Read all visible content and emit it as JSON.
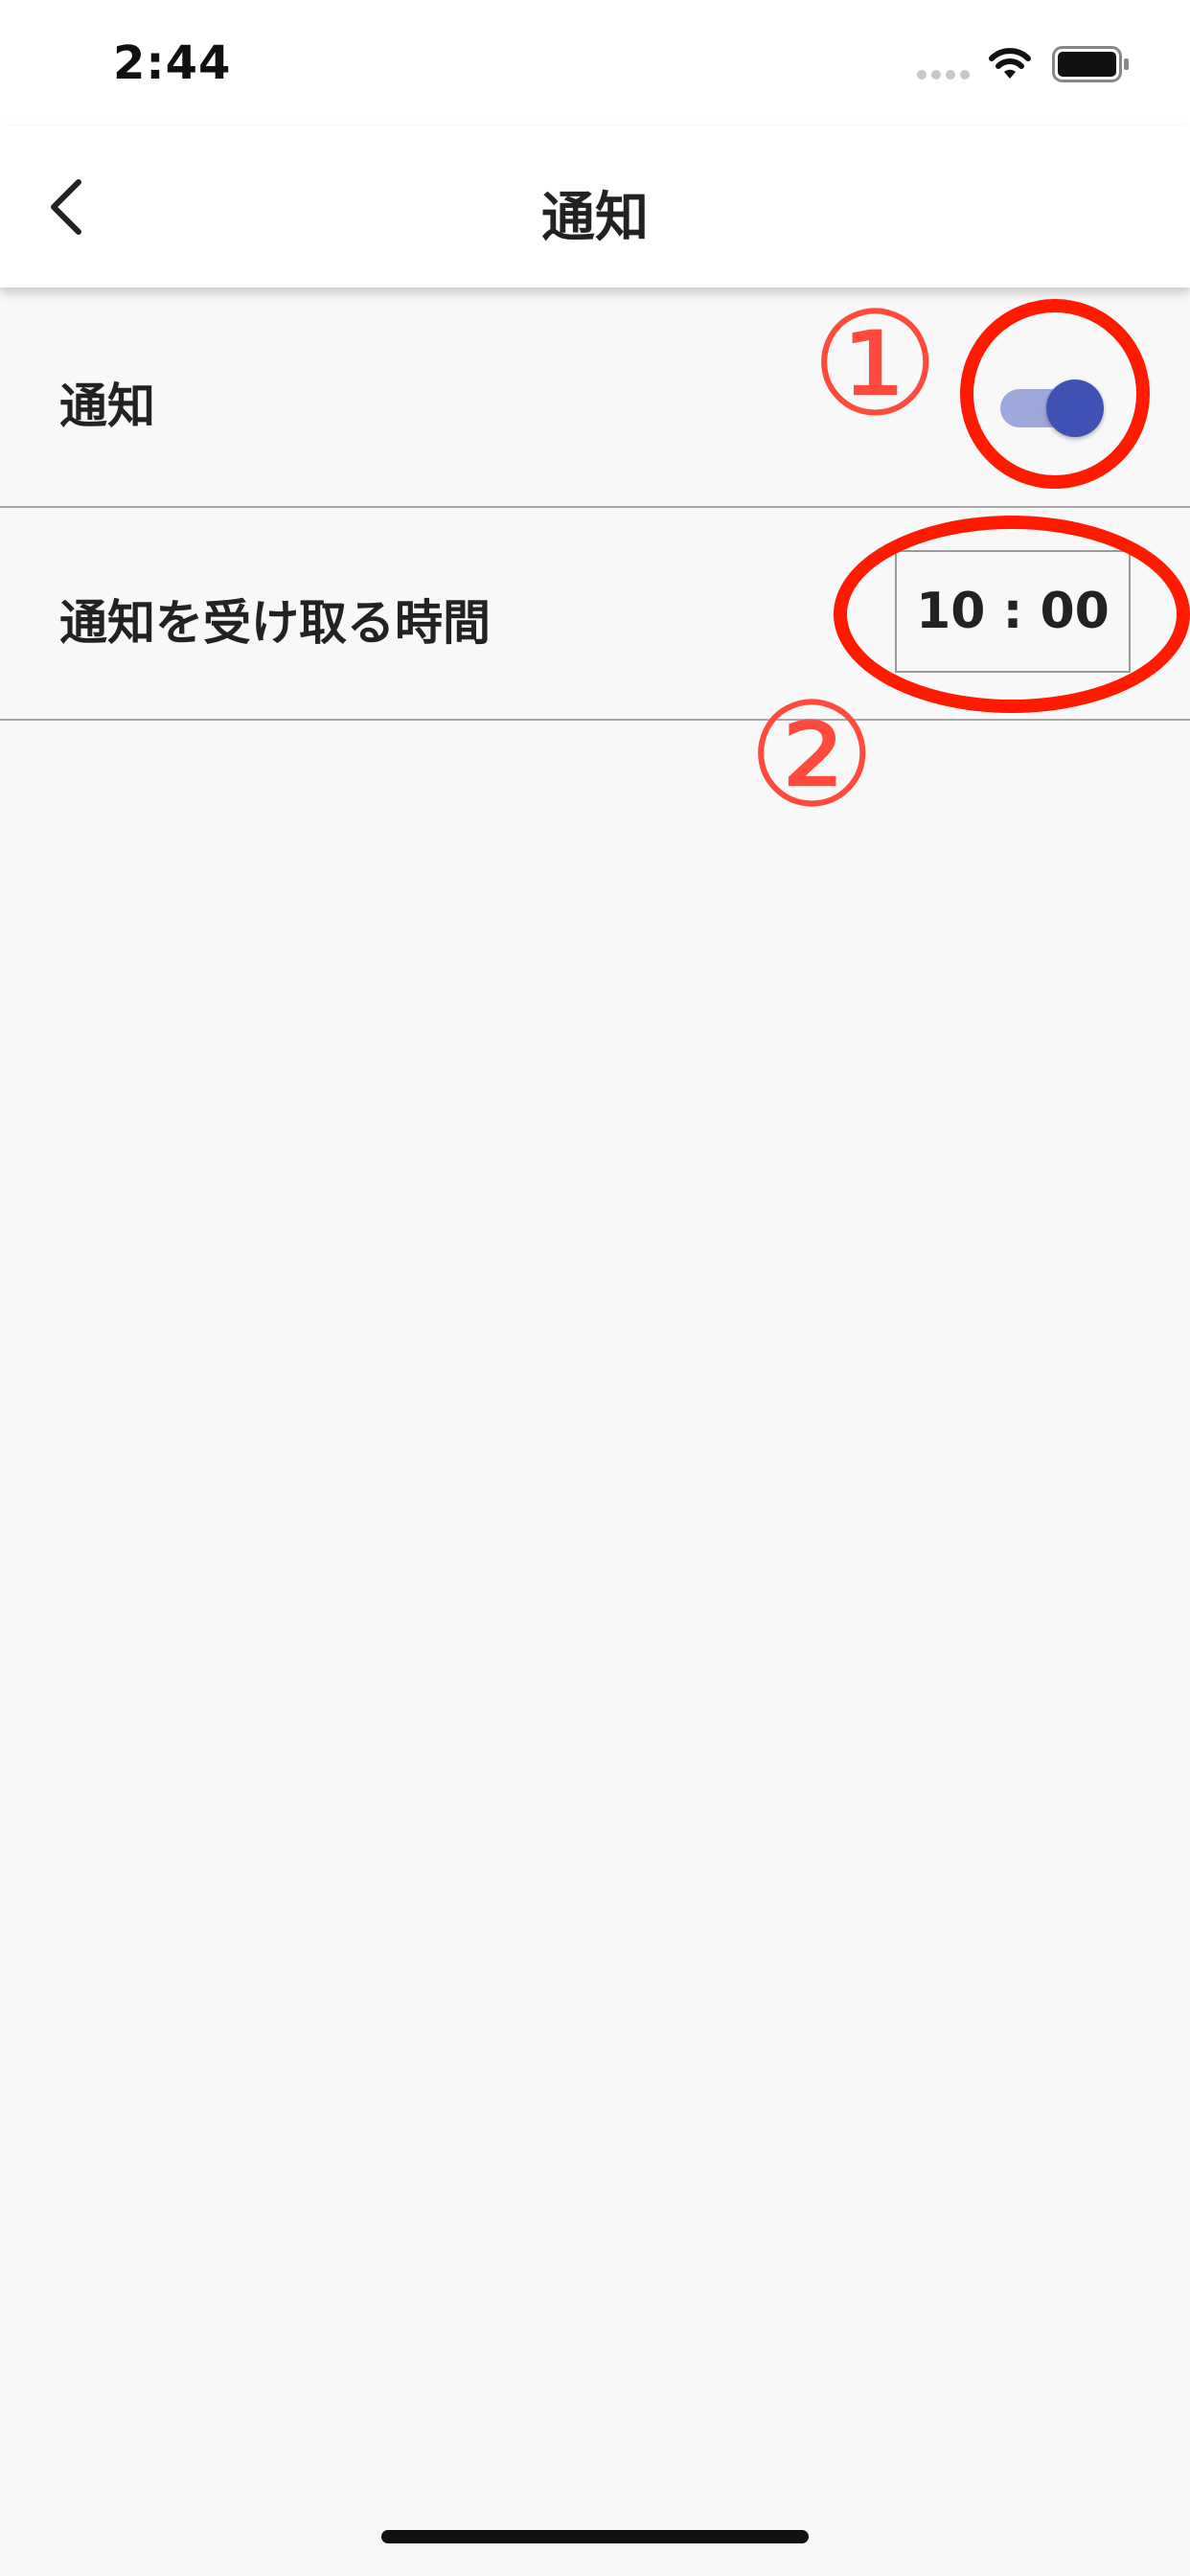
{
  "status_bar": {
    "time": "2:44",
    "icons": [
      "signal-dots-icon",
      "wifi-icon",
      "battery-icon"
    ]
  },
  "nav": {
    "title": "通知",
    "back_icon": "chevron-left-icon"
  },
  "settings": {
    "notification_row": {
      "label": "通知",
      "toggle_on": true
    },
    "time_row": {
      "label": "通知を受け取る時間",
      "value": "10 : 00"
    }
  },
  "annotations": {
    "marker_1": "①",
    "marker_2": "②"
  },
  "colors": {
    "accent": "#3f51b5",
    "toggle_track": "#9fa8da",
    "annotation_red": "#ff1a00",
    "annotation_number": "#ff4a3d",
    "background": "#f8f8f8",
    "divider": "#a8a8a8"
  }
}
